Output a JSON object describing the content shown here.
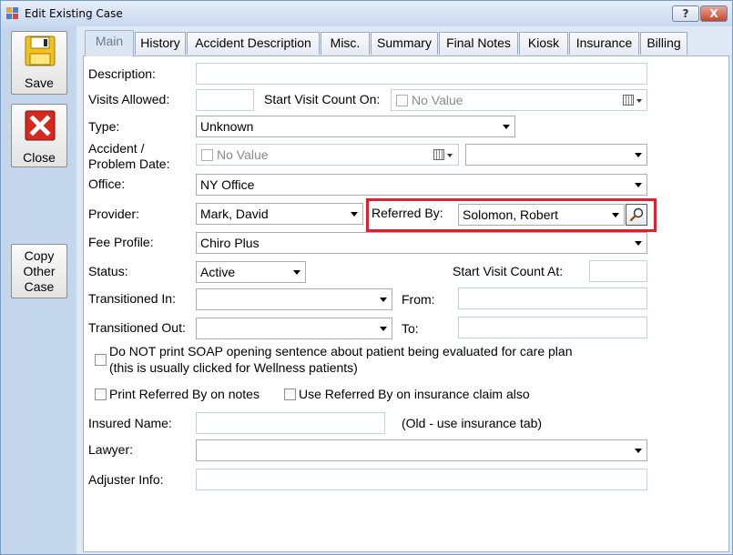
{
  "window": {
    "title": "Edit Existing Case",
    "help_label": "?",
    "close_label": "X"
  },
  "sidebar": {
    "save_label": "Save",
    "close_label": "Close",
    "copy_line1": "Copy",
    "copy_line2": "Other",
    "copy_line3": "Case"
  },
  "tabs": [
    "Main",
    "History",
    "Accident Description",
    "Misc.",
    "Summary",
    "Final Notes",
    "Kiosk",
    "Insurance",
    "Billing"
  ],
  "form": {
    "description_label": "Description:",
    "description_value": "",
    "visits_allowed_label": "Visits Allowed:",
    "visits_allowed_value": "",
    "start_visit_count_on_label": "Start Visit Count On:",
    "start_visit_count_on_value": "No Value",
    "type_label": "Type:",
    "type_value": "Unknown",
    "accident_label_line1": "Accident /",
    "accident_label_line2": "Problem Date:",
    "accident_date_value": "No Value",
    "accident_time_value": "",
    "office_label": "Office:",
    "office_value": "NY Office",
    "provider_label": "Provider:",
    "provider_value": "Mark, David",
    "referred_by_label": "Referred By:",
    "referred_by_value": "Solomon, Robert",
    "fee_profile_label": "Fee Profile:",
    "fee_profile_value": "Chiro Plus",
    "status_label": "Status:",
    "status_value": "Active",
    "start_visit_count_at_label": "Start Visit Count At:",
    "start_visit_count_at_value": "",
    "transitioned_in_label": "Transitioned In:",
    "transitioned_in_value": "",
    "from_label": "From:",
    "from_value": "",
    "transitioned_out_label": "Transitioned Out:",
    "transitioned_out_value": "",
    "to_label": "To:",
    "to_value": "",
    "soap_label_line1": "Do NOT print SOAP opening sentence about patient being evaluated for care plan",
    "soap_label_line2": "(this is usually clicked for Wellness patients)",
    "print_referred_label": "Print Referred By on notes",
    "use_referred_label": "Use Referred By on insurance claim also",
    "insured_name_label": "Insured Name:",
    "insured_name_value": "",
    "insured_note": "(Old - use insurance tab)",
    "lawyer_label": "Lawyer:",
    "lawyer_value": "",
    "adjuster_label": "Adjuster Info:",
    "adjuster_value": ""
  },
  "colors": {
    "highlight": "#e0202e",
    "sidebar_bg": "#c4d6ec",
    "panel_bg": "#ffffff"
  }
}
